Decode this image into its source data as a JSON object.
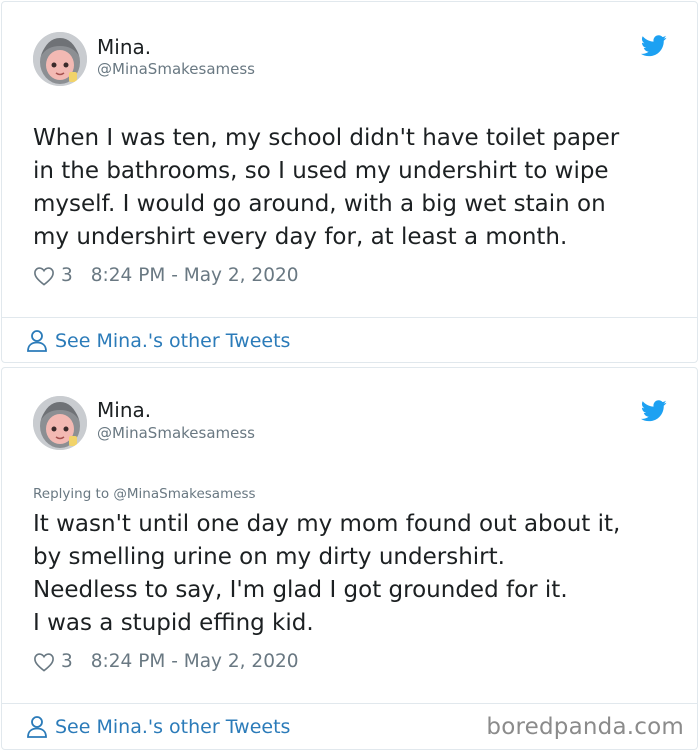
{
  "tweets": [
    {
      "author_name": "Mina.",
      "author_handle": "@MinaSmakesamess",
      "replying_to": "",
      "text_lines": [
        "When I was ten, my school didn't have toilet paper",
        "in the bathrooms, so I used my undershirt to wipe",
        "myself. I would go around, with a big wet stain on",
        "my undershirt every day for, at least a month."
      ],
      "likes": "3",
      "timestamp": "8:24 PM - May 2, 2020",
      "see_more": "See Mina.'s other Tweets"
    },
    {
      "author_name": "Mina.",
      "author_handle": "@MinaSmakesamess",
      "replying_to": "Replying to @MinaSmakesamess",
      "text_lines": [
        "It wasn't until one day my mom found out about it,",
        "by smelling urine on my dirty undershirt.",
        "Needless to say, I'm glad I got grounded for it.",
        "I was a stupid effing kid."
      ],
      "likes": "3",
      "timestamp": "8:24 PM - May 2, 2020",
      "see_more": "See Mina.'s other Tweets"
    }
  ],
  "watermark": "boredpanda.com",
  "colors": {
    "twitter_blue": "#1da1f2",
    "link_blue": "#2b7bb9",
    "meta_gray": "#697882",
    "border": "#e1e8ed"
  },
  "icons": [
    "twitter-bird-icon",
    "heart-icon",
    "person-icon"
  ]
}
